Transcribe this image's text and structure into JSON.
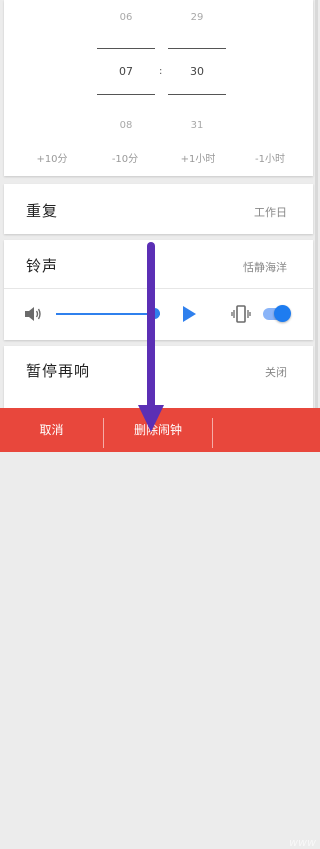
{
  "time_picker": {
    "hour_prev": "06",
    "hour_selected": "07",
    "hour_next": "08",
    "minute_prev": "29",
    "minute_selected": "30",
    "minute_next": "31",
    "separator": ":"
  },
  "quick_adjust": [
    "+10分",
    "-10分",
    "+1小时",
    "-1小时"
  ],
  "repeat": {
    "label": "重复",
    "value": "工作日"
  },
  "ringtone": {
    "label": "铃声",
    "value": "恬静海洋"
  },
  "volume": {
    "level": 0.95,
    "vibrate_enabled": true
  },
  "snooze": {
    "label": "暂停再响",
    "value": "关闭"
  },
  "bottom_bar": {
    "cancel": "取消",
    "delete": "删除闹钟",
    "watermark": "www"
  },
  "colors": {
    "accent": "#2f80ed",
    "bottom_bar": "#e8473c",
    "annotation_arrow": "#5b2fb5"
  }
}
